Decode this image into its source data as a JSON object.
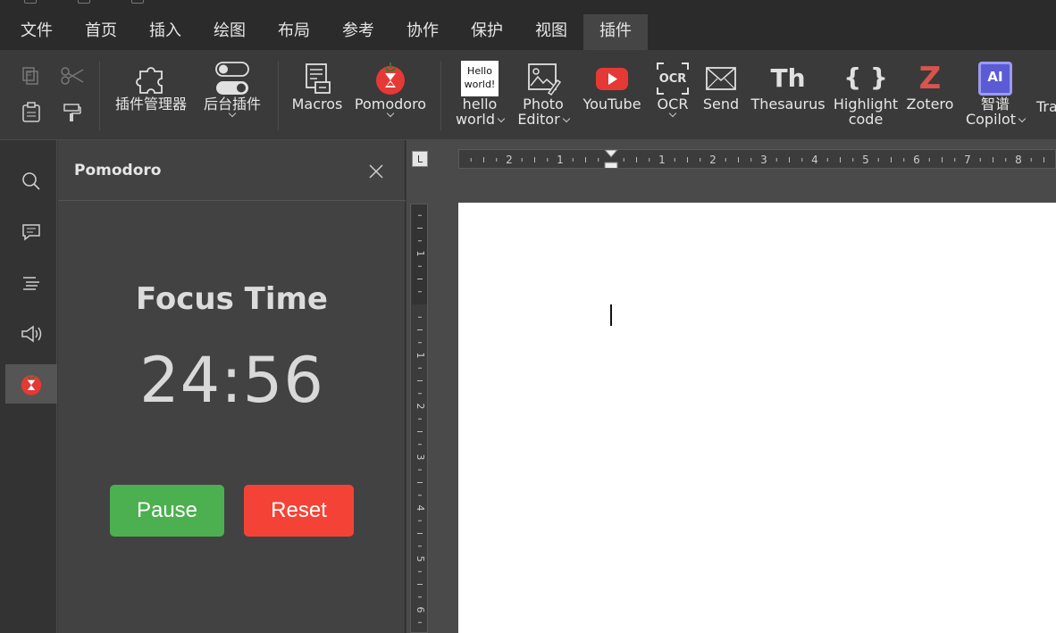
{
  "menu": {
    "tabs": [
      {
        "label": "文件"
      },
      {
        "label": "首页"
      },
      {
        "label": "插入"
      },
      {
        "label": "绘图"
      },
      {
        "label": "布局"
      },
      {
        "label": "参考"
      },
      {
        "label": "协作"
      },
      {
        "label": "保护"
      },
      {
        "label": "视图"
      },
      {
        "label": "插件"
      }
    ],
    "active_tab": "插件"
  },
  "ribbon": {
    "plugin_manager": "插件管理器",
    "background_plugins": "后台插件",
    "macros": "Macros",
    "pomodoro": "Pomodoro",
    "hello_world_icon_line1": "Hello",
    "hello_world_icon_line2": "world!",
    "hello_world": {
      "line1": "hello",
      "line2": "world"
    },
    "photo_editor": {
      "line1": "Photo",
      "line2": "Editor"
    },
    "youtube": "YouTube",
    "ocr_icon": "OCR",
    "ocr": "OCR",
    "send": "Send",
    "thesaurus_icon": "Th",
    "thesaurus": "Thesaurus",
    "highlight_icon": "{ }",
    "highlight_code": {
      "line1": "Highlight",
      "line2": "code"
    },
    "zotero_icon": "Z",
    "zotero": "Zotero",
    "copilot_icon": "AI",
    "copilot": {
      "line1": "智谱",
      "line2": "Copilot"
    },
    "overflow_label": "Tra"
  },
  "panel": {
    "title": "Pomodoro",
    "heading": "Focus Time",
    "time": "24:56",
    "pause_label": "Pause",
    "reset_label": "Reset"
  },
  "ruler": {
    "h_labels": [
      "2",
      "1",
      "1",
      "2",
      "3",
      "4",
      "5",
      "6",
      "7",
      "8"
    ],
    "v_labels": [
      "1",
      "1",
      "2",
      "3",
      "4",
      "5",
      "6"
    ]
  },
  "colors": {
    "pause": "#4caf50",
    "reset": "#f44336",
    "youtube": "#e53935",
    "zotero": "#d9534f",
    "copilot": "#5b5bd6",
    "tomato": "#e53935"
  }
}
